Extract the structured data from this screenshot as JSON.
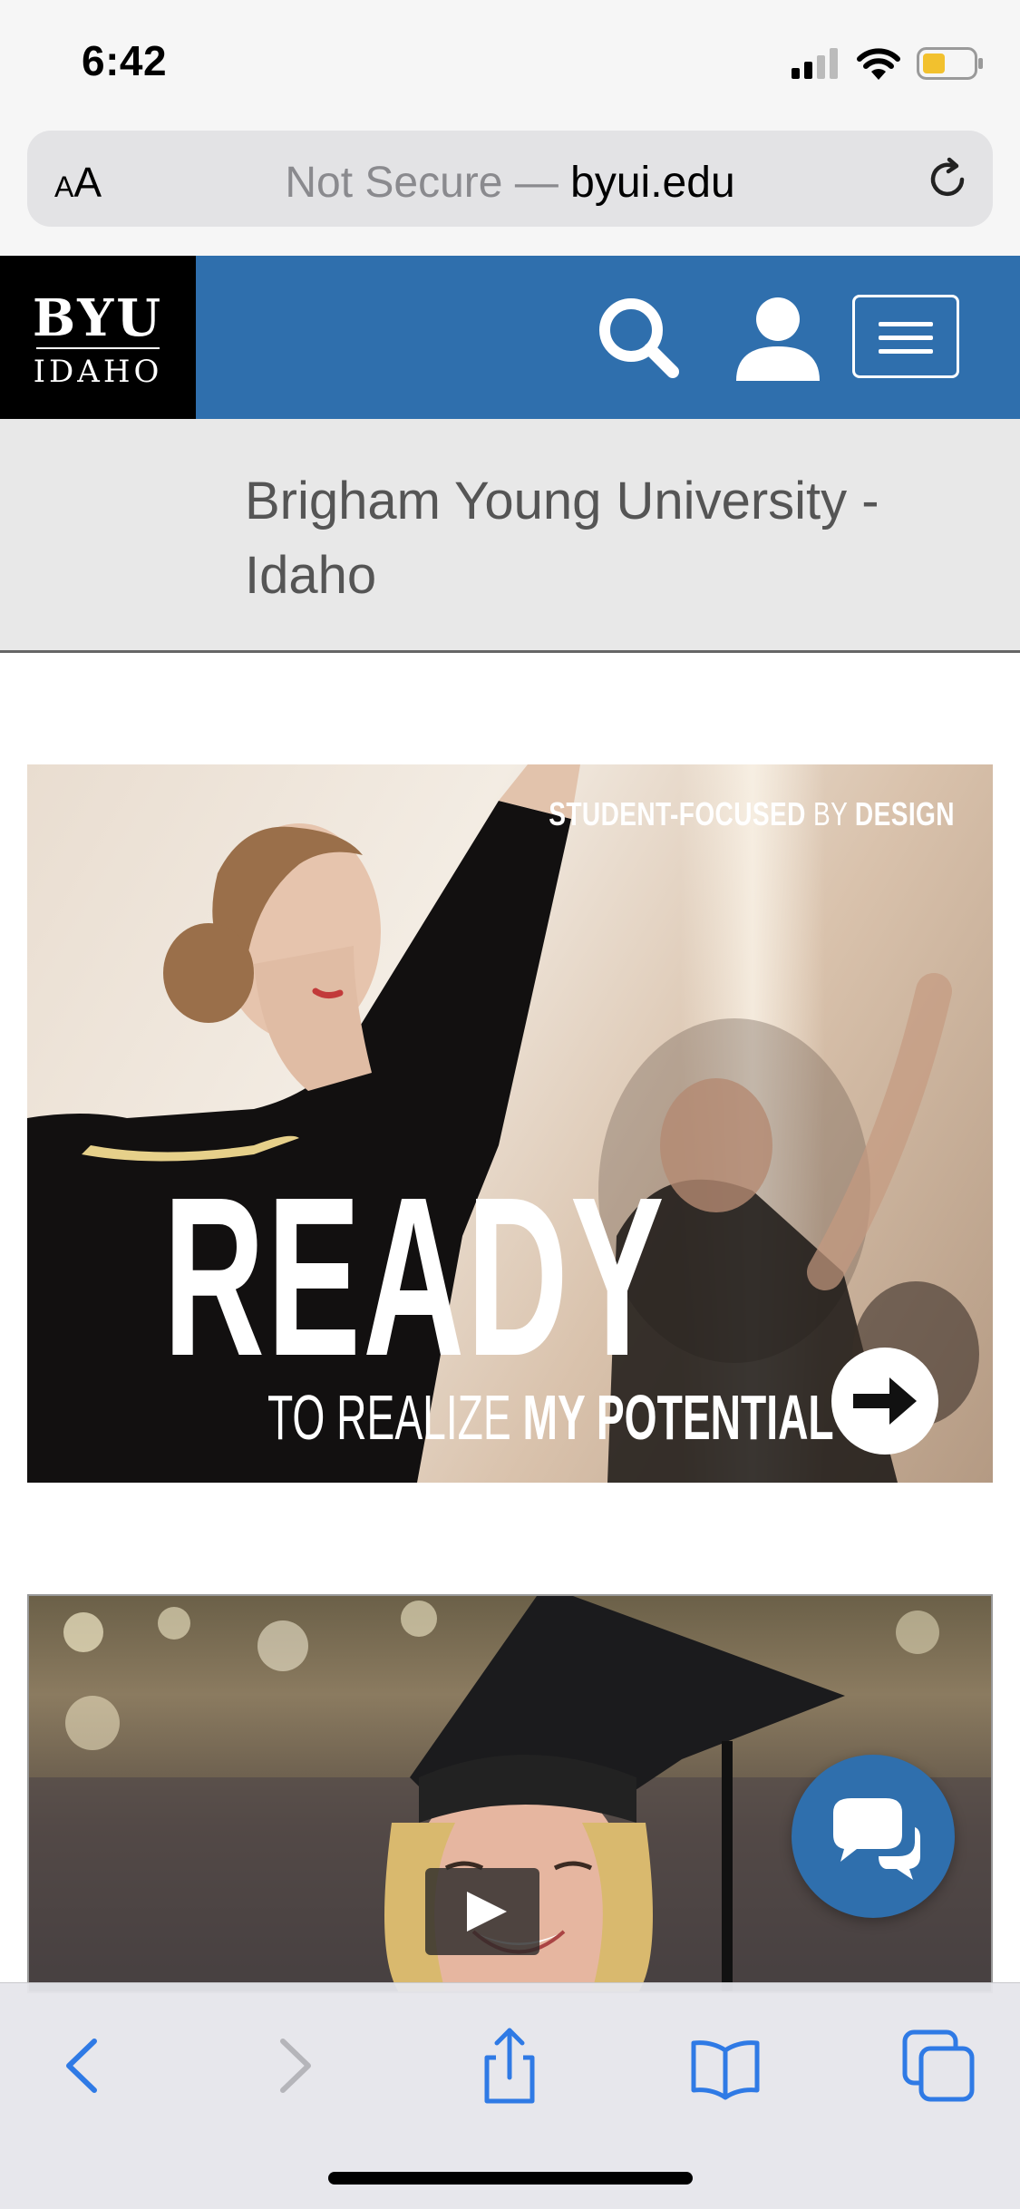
{
  "status_bar": {
    "time": "6:42"
  },
  "browser": {
    "text_size_label_small": "A",
    "text_size_label_large": "A",
    "url_prefix": "Not Secure — ",
    "url_domain": "byui.edu"
  },
  "header": {
    "logo_top": "BYU",
    "logo_bottom": "IDAHO",
    "accent_color": "#2f6fad"
  },
  "university_name": "Brigham Young University - Idaho",
  "hero": {
    "tag_part1": "STUDENT-FOCUSED",
    "tag_part2": " BY ",
    "tag_part3": "DESIGN",
    "headline": "READY",
    "sub_part1": "TO REALIZE ",
    "sub_part2": "MY POTENTIAL"
  },
  "icons": {
    "search": "search-icon",
    "user": "user-icon",
    "menu": "hamburger-menu-icon",
    "chat": "chat-bubbles-icon",
    "play": "play-icon",
    "back": "back-arrow-icon",
    "forward": "forward-arrow-icon",
    "share": "share-icon",
    "bookmarks": "bookmarks-icon",
    "tabs": "tabs-icon"
  }
}
